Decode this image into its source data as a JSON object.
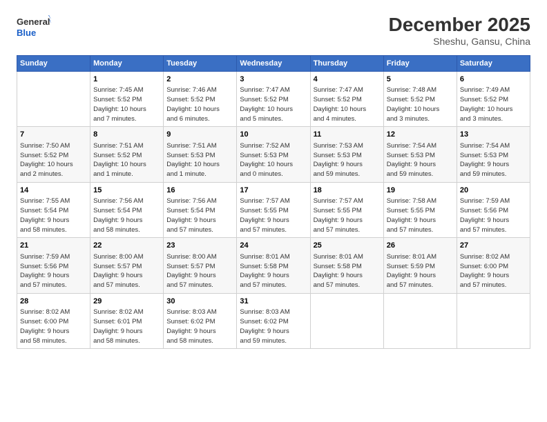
{
  "logo": {
    "line1": "General",
    "line2": "Blue"
  },
  "title": "December 2025",
  "subtitle": "Sheshu, Gansu, China",
  "headers": [
    "Sunday",
    "Monday",
    "Tuesday",
    "Wednesday",
    "Thursday",
    "Friday",
    "Saturday"
  ],
  "weeks": [
    [
      {
        "num": "",
        "info": ""
      },
      {
        "num": "1",
        "info": "Sunrise: 7:45 AM\nSunset: 5:52 PM\nDaylight: 10 hours\nand 7 minutes."
      },
      {
        "num": "2",
        "info": "Sunrise: 7:46 AM\nSunset: 5:52 PM\nDaylight: 10 hours\nand 6 minutes."
      },
      {
        "num": "3",
        "info": "Sunrise: 7:47 AM\nSunset: 5:52 PM\nDaylight: 10 hours\nand 5 minutes."
      },
      {
        "num": "4",
        "info": "Sunrise: 7:47 AM\nSunset: 5:52 PM\nDaylight: 10 hours\nand 4 minutes."
      },
      {
        "num": "5",
        "info": "Sunrise: 7:48 AM\nSunset: 5:52 PM\nDaylight: 10 hours\nand 3 minutes."
      },
      {
        "num": "6",
        "info": "Sunrise: 7:49 AM\nSunset: 5:52 PM\nDaylight: 10 hours\nand 3 minutes."
      }
    ],
    [
      {
        "num": "7",
        "info": "Sunrise: 7:50 AM\nSunset: 5:52 PM\nDaylight: 10 hours\nand 2 minutes."
      },
      {
        "num": "8",
        "info": "Sunrise: 7:51 AM\nSunset: 5:52 PM\nDaylight: 10 hours\nand 1 minute."
      },
      {
        "num": "9",
        "info": "Sunrise: 7:51 AM\nSunset: 5:53 PM\nDaylight: 10 hours\nand 1 minute."
      },
      {
        "num": "10",
        "info": "Sunrise: 7:52 AM\nSunset: 5:53 PM\nDaylight: 10 hours\nand 0 minutes."
      },
      {
        "num": "11",
        "info": "Sunrise: 7:53 AM\nSunset: 5:53 PM\nDaylight: 9 hours\nand 59 minutes."
      },
      {
        "num": "12",
        "info": "Sunrise: 7:54 AM\nSunset: 5:53 PM\nDaylight: 9 hours\nand 59 minutes."
      },
      {
        "num": "13",
        "info": "Sunrise: 7:54 AM\nSunset: 5:53 PM\nDaylight: 9 hours\nand 59 minutes."
      }
    ],
    [
      {
        "num": "14",
        "info": "Sunrise: 7:55 AM\nSunset: 5:54 PM\nDaylight: 9 hours\nand 58 minutes."
      },
      {
        "num": "15",
        "info": "Sunrise: 7:56 AM\nSunset: 5:54 PM\nDaylight: 9 hours\nand 58 minutes."
      },
      {
        "num": "16",
        "info": "Sunrise: 7:56 AM\nSunset: 5:54 PM\nDaylight: 9 hours\nand 57 minutes."
      },
      {
        "num": "17",
        "info": "Sunrise: 7:57 AM\nSunset: 5:55 PM\nDaylight: 9 hours\nand 57 minutes."
      },
      {
        "num": "18",
        "info": "Sunrise: 7:57 AM\nSunset: 5:55 PM\nDaylight: 9 hours\nand 57 minutes."
      },
      {
        "num": "19",
        "info": "Sunrise: 7:58 AM\nSunset: 5:55 PM\nDaylight: 9 hours\nand 57 minutes."
      },
      {
        "num": "20",
        "info": "Sunrise: 7:59 AM\nSunset: 5:56 PM\nDaylight: 9 hours\nand 57 minutes."
      }
    ],
    [
      {
        "num": "21",
        "info": "Sunrise: 7:59 AM\nSunset: 5:56 PM\nDaylight: 9 hours\nand 57 minutes."
      },
      {
        "num": "22",
        "info": "Sunrise: 8:00 AM\nSunset: 5:57 PM\nDaylight: 9 hours\nand 57 minutes."
      },
      {
        "num": "23",
        "info": "Sunrise: 8:00 AM\nSunset: 5:57 PM\nDaylight: 9 hours\nand 57 minutes."
      },
      {
        "num": "24",
        "info": "Sunrise: 8:01 AM\nSunset: 5:58 PM\nDaylight: 9 hours\nand 57 minutes."
      },
      {
        "num": "25",
        "info": "Sunrise: 8:01 AM\nSunset: 5:58 PM\nDaylight: 9 hours\nand 57 minutes."
      },
      {
        "num": "26",
        "info": "Sunrise: 8:01 AM\nSunset: 5:59 PM\nDaylight: 9 hours\nand 57 minutes."
      },
      {
        "num": "27",
        "info": "Sunrise: 8:02 AM\nSunset: 6:00 PM\nDaylight: 9 hours\nand 57 minutes."
      }
    ],
    [
      {
        "num": "28",
        "info": "Sunrise: 8:02 AM\nSunset: 6:00 PM\nDaylight: 9 hours\nand 58 minutes."
      },
      {
        "num": "29",
        "info": "Sunrise: 8:02 AM\nSunset: 6:01 PM\nDaylight: 9 hours\nand 58 minutes."
      },
      {
        "num": "30",
        "info": "Sunrise: 8:03 AM\nSunset: 6:02 PM\nDaylight: 9 hours\nand 58 minutes."
      },
      {
        "num": "31",
        "info": "Sunrise: 8:03 AM\nSunset: 6:02 PM\nDaylight: 9 hours\nand 59 minutes."
      },
      {
        "num": "",
        "info": ""
      },
      {
        "num": "",
        "info": ""
      },
      {
        "num": "",
        "info": ""
      }
    ]
  ]
}
